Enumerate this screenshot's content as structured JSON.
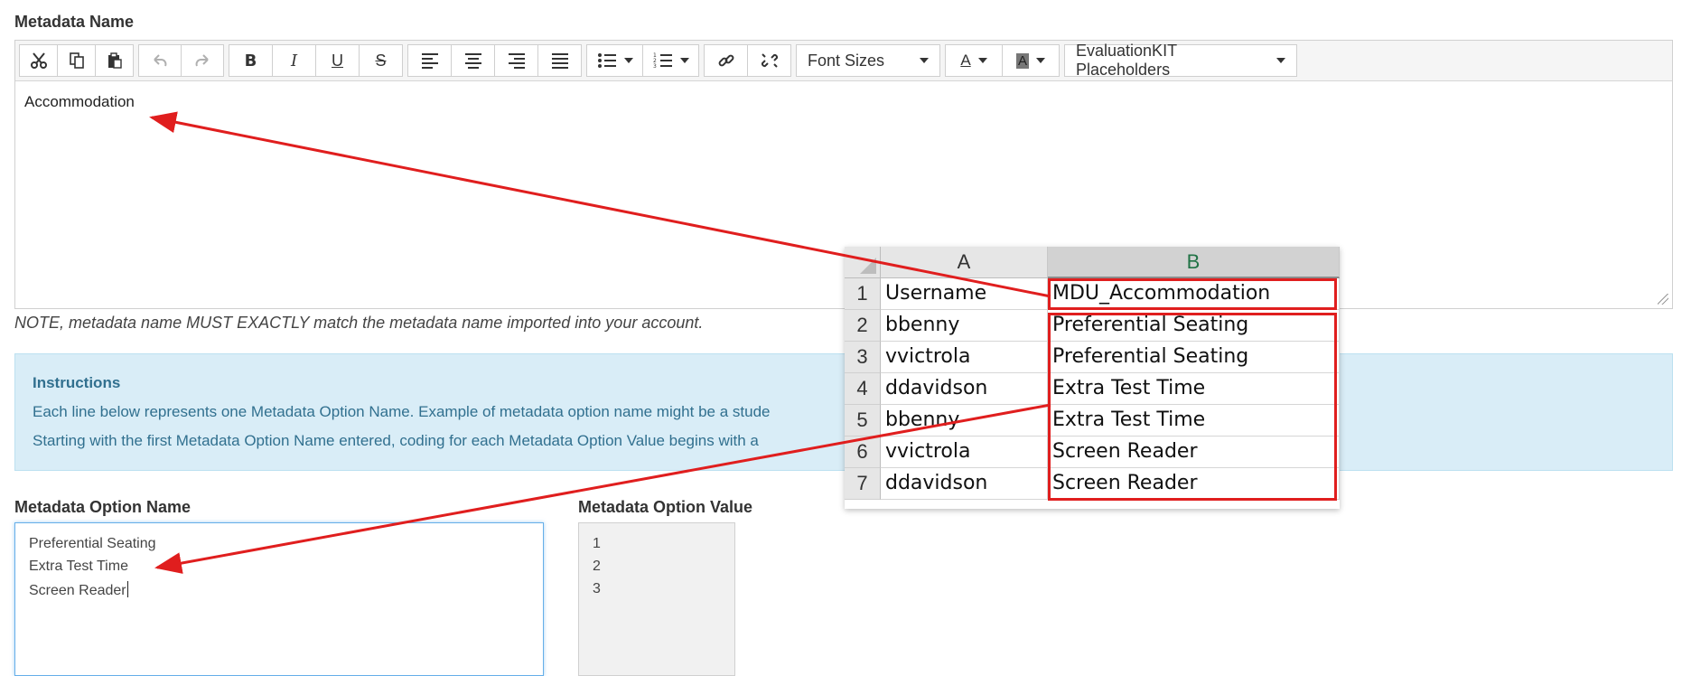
{
  "metadata_name": {
    "label": "Metadata Name",
    "editor_value": "Accommodation",
    "note": "NOTE, metadata name MUST EXACTLY match the metadata name imported into your account."
  },
  "toolbar": {
    "font_sizes": "Font Sizes",
    "placeholders": "EvaluationKIT Placeholders",
    "font_color_glyph": "A",
    "bg_color_glyph": "A",
    "bold_glyph": "B",
    "italic_glyph": "I",
    "underline_glyph": "U",
    "strike_glyph": "S"
  },
  "instructions": {
    "title": "Instructions",
    "line1": "Each line below represents one Metadata Option Name. Example of metadata option name might be a stude",
    "line2": "Starting with the first Metadata Option Name entered, coding for each Metadata Option Value begins with a"
  },
  "option_name": {
    "label": "Metadata Option Name",
    "lines": [
      "Preferential Seating",
      "Extra Test Time",
      "Screen Reader"
    ]
  },
  "option_value": {
    "label": "Metadata Option Value",
    "lines": [
      "1",
      "2",
      "3"
    ]
  },
  "spreadsheet": {
    "columns": [
      "A",
      "B"
    ],
    "rows": [
      {
        "num": "1",
        "a": "Username",
        "b": "MDU_Accommodation"
      },
      {
        "num": "2",
        "a": "bbenny",
        "b": "Preferential Seating"
      },
      {
        "num": "3",
        "a": "vvictrola",
        "b": "Preferential Seating"
      },
      {
        "num": "4",
        "a": "ddavidson",
        "b": "Extra Test Time"
      },
      {
        "num": "5",
        "a": "bbenny",
        "b": "Extra Test Time"
      },
      {
        "num": "6",
        "a": "vvictrola",
        "b": "Screen Reader"
      },
      {
        "num": "7",
        "a": "ddavidson",
        "b": "Screen Reader"
      }
    ]
  },
  "colors": {
    "annotation_red": "#e01e1e",
    "info_bg": "#d9edf7",
    "info_text": "#31708f",
    "focus_border": "#66afe9"
  }
}
